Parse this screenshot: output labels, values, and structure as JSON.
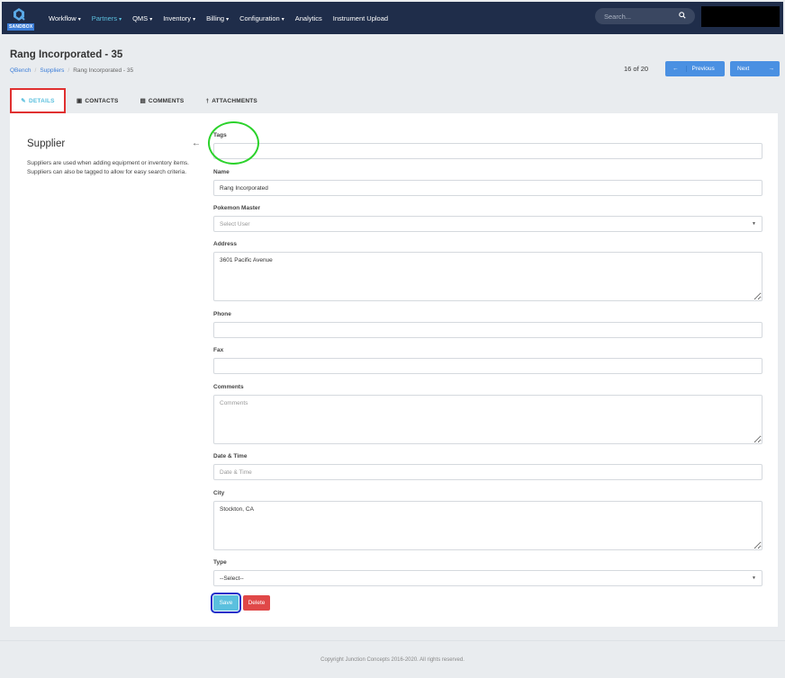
{
  "navbar": {
    "sandbox_label": "SANDBOX",
    "items": [
      {
        "label": "Workflow",
        "caret": "▾",
        "active": false
      },
      {
        "label": "Partners",
        "caret": "▾",
        "active": true
      },
      {
        "label": "QMS",
        "caret": "▾",
        "active": false
      },
      {
        "label": "Inventory",
        "caret": "▾",
        "active": false
      },
      {
        "label": "Billing",
        "caret": "▾",
        "active": false
      },
      {
        "label": "Configuration",
        "caret": "▾",
        "active": false
      },
      {
        "label": "Analytics",
        "caret": "",
        "active": false
      },
      {
        "label": "Instrument Upload",
        "caret": "",
        "active": false
      }
    ],
    "search_placeholder": "Search...",
    "search_icon": "search-icon"
  },
  "header": {
    "title": "Rang Incorporated - 35",
    "breadcrumb": [
      "QBench",
      "Suppliers",
      "Rang Incorporated - 35"
    ],
    "pager": "16 of 20",
    "prev_label": "Previous",
    "next_label": "Next"
  },
  "tabs": [
    {
      "label": "DETAILS",
      "icon": "pencil-icon",
      "active": true
    },
    {
      "label": "CONTACTS",
      "icon": "address-book-icon",
      "active": false
    },
    {
      "label": "COMMENTS",
      "icon": "comment-icon",
      "active": false
    },
    {
      "label": "ATTACHMENTS",
      "icon": "paperclip-icon",
      "active": false
    }
  ],
  "sidebar": {
    "title": "Supplier",
    "description": "Suppliers are used when adding equipment or inventory items. Suppliers can also be tagged to allow for easy search criteria."
  },
  "form": {
    "tags": {
      "label": "Tags",
      "value": ""
    },
    "name": {
      "label": "Name",
      "value": "Rang Incorporated"
    },
    "pokemon_master": {
      "label": "Pokemon Master",
      "placeholder": "Select User"
    },
    "address": {
      "label": "Address",
      "value": "3601 Pacific Avenue"
    },
    "phone": {
      "label": "Phone",
      "value": ""
    },
    "fax": {
      "label": "Fax",
      "value": ""
    },
    "comments": {
      "label": "Comments",
      "placeholder": "Comments"
    },
    "datetime": {
      "label": "Date & Time",
      "placeholder": "Date & Time"
    },
    "city": {
      "label": "City",
      "value": "Stockton, CA"
    },
    "type": {
      "label": "Type",
      "value": "--Select--"
    },
    "save_label": "Save",
    "delete_label": "Delete"
  },
  "footer": {
    "copyright": "Copyright Junction Concepts 2016-2020. All rights reserved."
  },
  "colors": {
    "navbar_bg": "#1f2d4a",
    "accent": "#5bc0de",
    "primary": "#4a90e2",
    "danger": "#e04848"
  }
}
